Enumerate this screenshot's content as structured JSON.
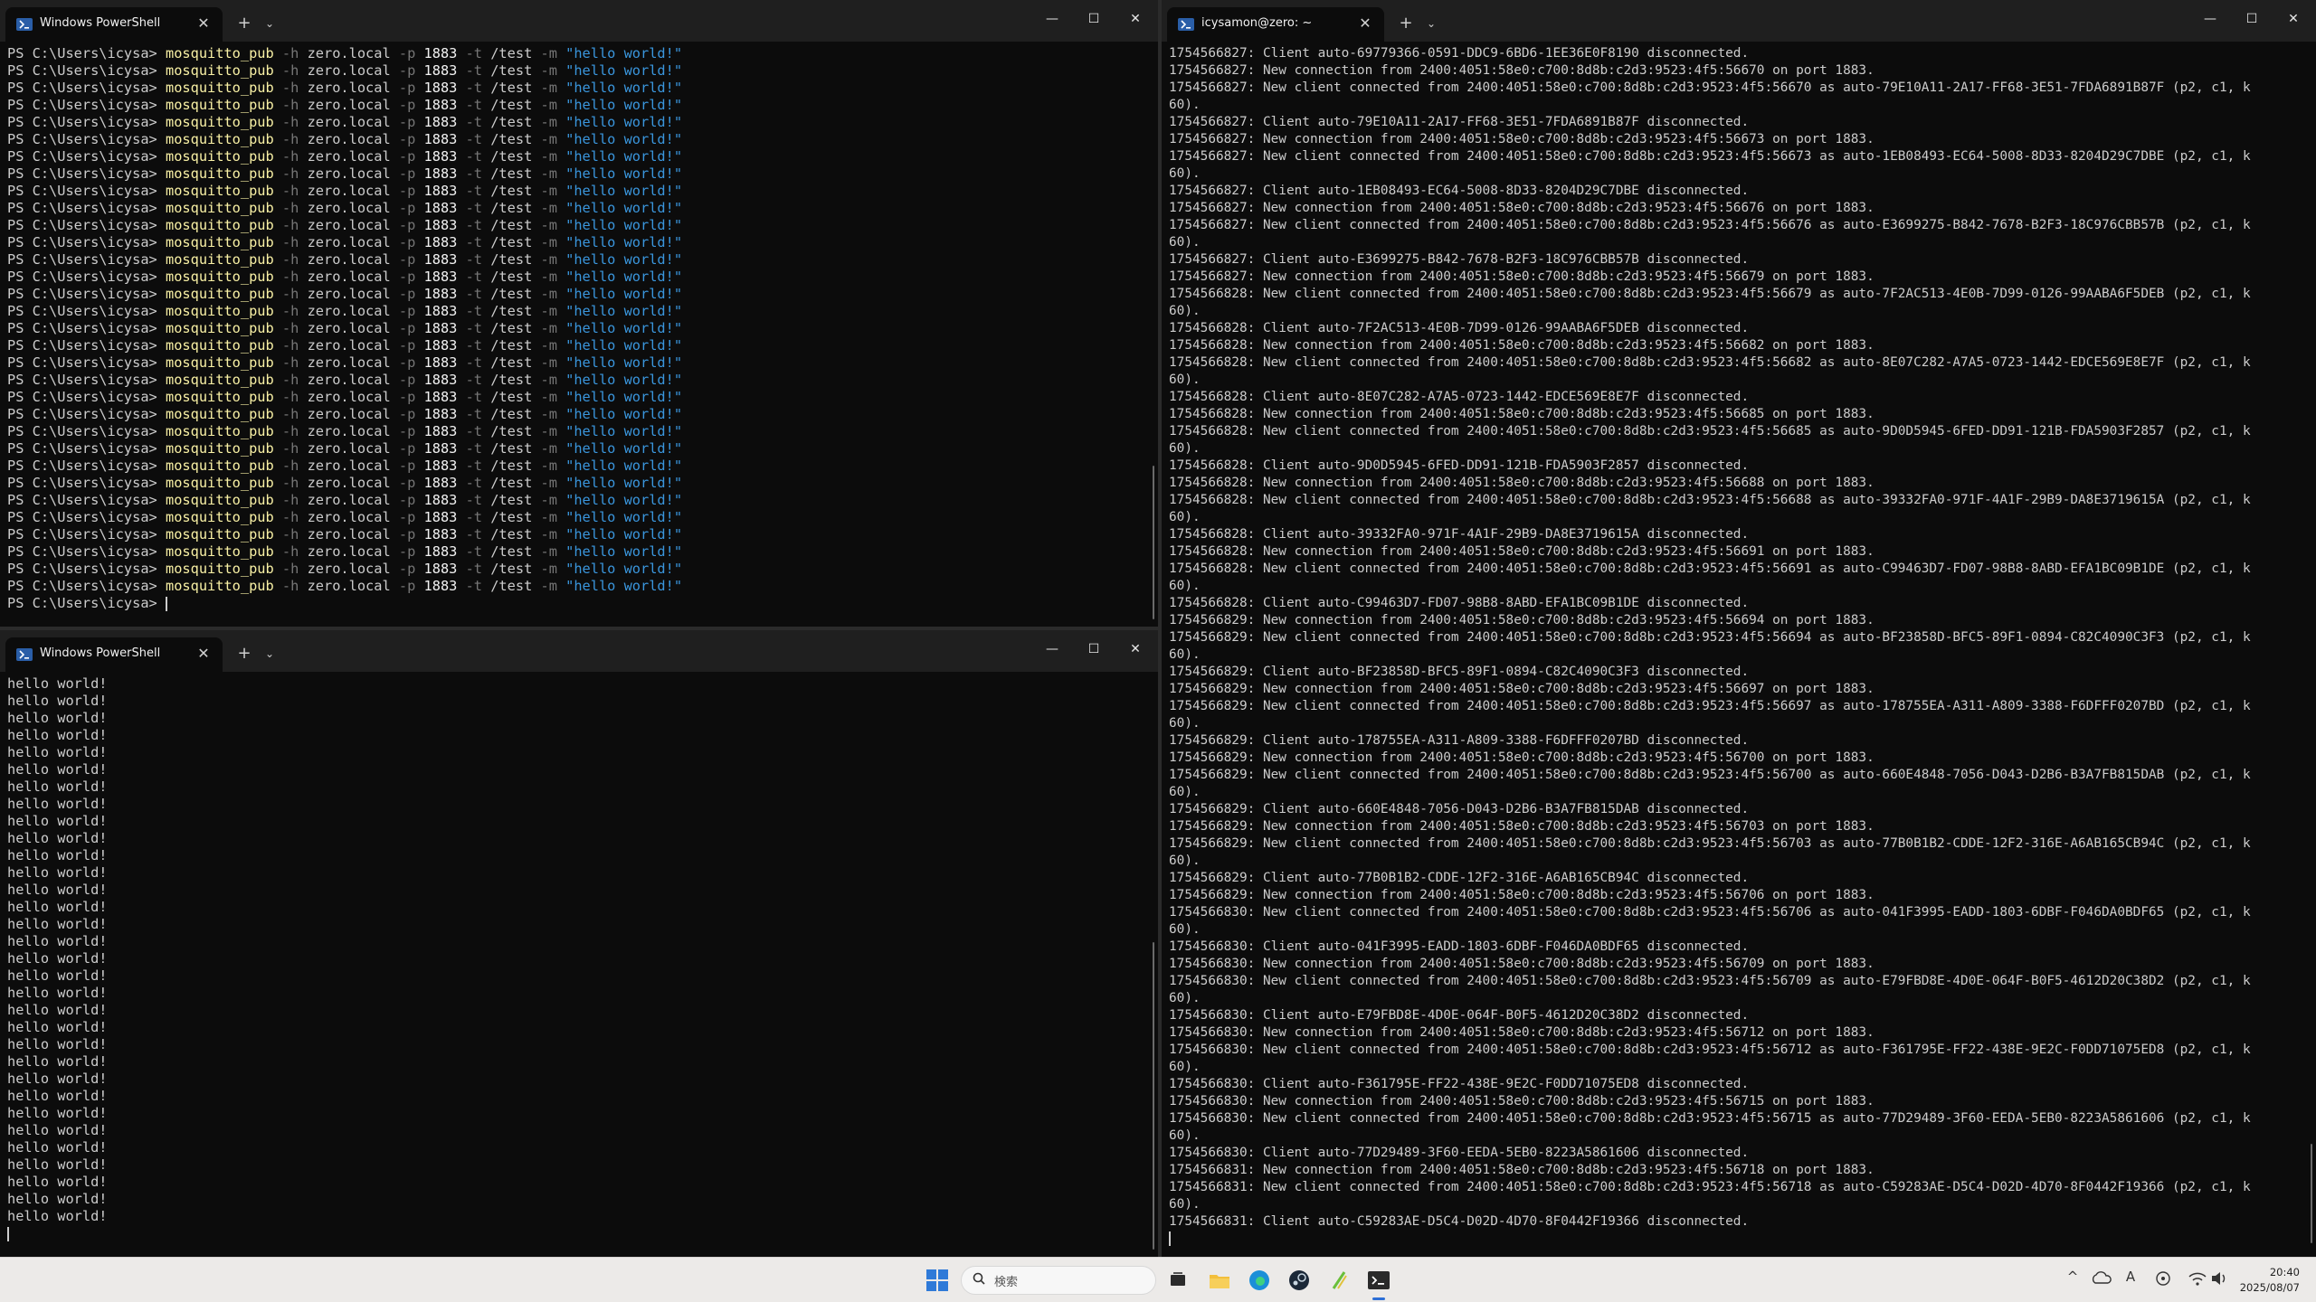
{
  "windows": {
    "top_left": {
      "tab_title": "Windows PowerShell",
      "command": {
        "prompt": "PS C:\\Users\\icysa> ",
        "exe": "mosquitto_pub",
        "h_flag": "-h",
        "host": "zero.local",
        "p_flag": "-p",
        "port": "1883",
        "t_flag": "-t",
        "topic": "/test",
        "m_flag": "-m",
        "message": "\"hello world!\"",
        "repeat": 32
      },
      "final_prompt": "PS C:\\Users\\icysa> "
    },
    "bottom_left": {
      "tab_title": "Windows PowerShell",
      "line": "hello world!",
      "repeat": 32
    },
    "right": {
      "tab_title": "icysamon@zero: ~",
      "lines": [
        "1754566827: Client auto-69779366-0591-DDC9-6BD6-1EE36E0F8190 disconnected.",
        "1754566827: New connection from 2400:4051:58e0:c700:8d8b:c2d3:9523:4f5:56670 on port 1883.",
        "1754566827: New client connected from 2400:4051:58e0:c700:8d8b:c2d3:9523:4f5:56670 as auto-79E10A11-2A17-FF68-3E51-7FDA6891B87F (p2, c1, k",
        "60).",
        "1754566827: Client auto-79E10A11-2A17-FF68-3E51-7FDA6891B87F disconnected.",
        "1754566827: New connection from 2400:4051:58e0:c700:8d8b:c2d3:9523:4f5:56673 on port 1883.",
        "1754566827: New client connected from 2400:4051:58e0:c700:8d8b:c2d3:9523:4f5:56673 as auto-1EB08493-EC64-5008-8D33-8204D29C7DBE (p2, c1, k",
        "60).",
        "1754566827: Client auto-1EB08493-EC64-5008-8D33-8204D29C7DBE disconnected.",
        "1754566827: New connection from 2400:4051:58e0:c700:8d8b:c2d3:9523:4f5:56676 on port 1883.",
        "1754566827: New client connected from 2400:4051:58e0:c700:8d8b:c2d3:9523:4f5:56676 as auto-E3699275-B842-7678-B2F3-18C976CBB57B (p2, c1, k",
        "60).",
        "1754566827: Client auto-E3699275-B842-7678-B2F3-18C976CBB57B disconnected.",
        "1754566827: New connection from 2400:4051:58e0:c700:8d8b:c2d3:9523:4f5:56679 on port 1883.",
        "1754566828: New client connected from 2400:4051:58e0:c700:8d8b:c2d3:9523:4f5:56679 as auto-7F2AC513-4E0B-7D99-0126-99AABA6F5DEB (p2, c1, k",
        "60).",
        "1754566828: Client auto-7F2AC513-4E0B-7D99-0126-99AABA6F5DEB disconnected.",
        "1754566828: New connection from 2400:4051:58e0:c700:8d8b:c2d3:9523:4f5:56682 on port 1883.",
        "1754566828: New client connected from 2400:4051:58e0:c700:8d8b:c2d3:9523:4f5:56682 as auto-8E07C282-A7A5-0723-1442-EDCE569E8E7F (p2, c1, k",
        "60).",
        "1754566828: Client auto-8E07C282-A7A5-0723-1442-EDCE569E8E7F disconnected.",
        "1754566828: New connection from 2400:4051:58e0:c700:8d8b:c2d3:9523:4f5:56685 on port 1883.",
        "1754566828: New client connected from 2400:4051:58e0:c700:8d8b:c2d3:9523:4f5:56685 as auto-9D0D5945-6FED-DD91-121B-FDA5903F2857 (p2, c1, k",
        "60).",
        "1754566828: Client auto-9D0D5945-6FED-DD91-121B-FDA5903F2857 disconnected.",
        "1754566828: New connection from 2400:4051:58e0:c700:8d8b:c2d3:9523:4f5:56688 on port 1883.",
        "1754566828: New client connected from 2400:4051:58e0:c700:8d8b:c2d3:9523:4f5:56688 as auto-39332FA0-971F-4A1F-29B9-DA8E3719615A (p2, c1, k",
        "60).",
        "1754566828: Client auto-39332FA0-971F-4A1F-29B9-DA8E3719615A disconnected.",
        "1754566828: New connection from 2400:4051:58e0:c700:8d8b:c2d3:9523:4f5:56691 on port 1883.",
        "1754566828: New client connected from 2400:4051:58e0:c700:8d8b:c2d3:9523:4f5:56691 as auto-C99463D7-FD07-98B8-8ABD-EFA1BC09B1DE (p2, c1, k",
        "60).",
        "1754566828: Client auto-C99463D7-FD07-98B8-8ABD-EFA1BC09B1DE disconnected.",
        "1754566829: New connection from 2400:4051:58e0:c700:8d8b:c2d3:9523:4f5:56694 on port 1883.",
        "1754566829: New client connected from 2400:4051:58e0:c700:8d8b:c2d3:9523:4f5:56694 as auto-BF23858D-BFC5-89F1-0894-C82C4090C3F3 (p2, c1, k",
        "60).",
        "1754566829: Client auto-BF23858D-BFC5-89F1-0894-C82C4090C3F3 disconnected.",
        "1754566829: New connection from 2400:4051:58e0:c700:8d8b:c2d3:9523:4f5:56697 on port 1883.",
        "1754566829: New client connected from 2400:4051:58e0:c700:8d8b:c2d3:9523:4f5:56697 as auto-178755EA-A311-A809-3388-F6DFFF0207BD (p2, c1, k",
        "60).",
        "1754566829: Client auto-178755EA-A311-A809-3388-F6DFFF0207BD disconnected.",
        "1754566829: New connection from 2400:4051:58e0:c700:8d8b:c2d3:9523:4f5:56700 on port 1883.",
        "1754566829: New client connected from 2400:4051:58e0:c700:8d8b:c2d3:9523:4f5:56700 as auto-660E4848-7056-D043-D2B6-B3A7FB815DAB (p2, c1, k",
        "60).",
        "1754566829: Client auto-660E4848-7056-D043-D2B6-B3A7FB815DAB disconnected.",
        "1754566829: New connection from 2400:4051:58e0:c700:8d8b:c2d3:9523:4f5:56703 on port 1883.",
        "1754566829: New client connected from 2400:4051:58e0:c700:8d8b:c2d3:9523:4f5:56703 as auto-77B0B1B2-CDDE-12F2-316E-A6AB165CB94C (p2, c1, k",
        "60).",
        "1754566829: Client auto-77B0B1B2-CDDE-12F2-316E-A6AB165CB94C disconnected.",
        "1754566829: New connection from 2400:4051:58e0:c700:8d8b:c2d3:9523:4f5:56706 on port 1883.",
        "1754566830: New client connected from 2400:4051:58e0:c700:8d8b:c2d3:9523:4f5:56706 as auto-041F3995-EADD-1803-6DBF-F046DA0BDF65 (p2, c1, k",
        "60).",
        "1754566830: Client auto-041F3995-EADD-1803-6DBF-F046DA0BDF65 disconnected.",
        "1754566830: New connection from 2400:4051:58e0:c700:8d8b:c2d3:9523:4f5:56709 on port 1883.",
        "1754566830: New client connected from 2400:4051:58e0:c700:8d8b:c2d3:9523:4f5:56709 as auto-E79FBD8E-4D0E-064F-B0F5-4612D20C38D2 (p2, c1, k",
        "60).",
        "1754566830: Client auto-E79FBD8E-4D0E-064F-B0F5-4612D20C38D2 disconnected.",
        "1754566830: New connection from 2400:4051:58e0:c700:8d8b:c2d3:9523:4f5:56712 on port 1883.",
        "1754566830: New client connected from 2400:4051:58e0:c700:8d8b:c2d3:9523:4f5:56712 as auto-F361795E-FF22-438E-9E2C-F0DD71075ED8 (p2, c1, k",
        "60).",
        "1754566830: Client auto-F361795E-FF22-438E-9E2C-F0DD71075ED8 disconnected.",
        "1754566830: New connection from 2400:4051:58e0:c700:8d8b:c2d3:9523:4f5:56715 on port 1883.",
        "1754566830: New client connected from 2400:4051:58e0:c700:8d8b:c2d3:9523:4f5:56715 as auto-77D29489-3F60-EEDA-5EB0-8223A5861606 (p2, c1, k",
        "60).",
        "1754566830: Client auto-77D29489-3F60-EEDA-5EB0-8223A5861606 disconnected.",
        "1754566831: New connection from 2400:4051:58e0:c700:8d8b:c2d3:9523:4f5:56718 on port 1883.",
        "1754566831: New client connected from 2400:4051:58e0:c700:8d8b:c2d3:9523:4f5:56718 as auto-C59283AE-D5C4-D02D-4D70-8F0442F19366 (p2, c1, k",
        "60).",
        "1754566831: Client auto-C59283AE-D5C4-D02D-4D70-8F0442F19366 disconnected."
      ]
    },
    "window_controls": {
      "minimize": "—",
      "maximize": "☐",
      "close": "✕"
    },
    "tab_controls": {
      "close": "✕",
      "new_tab": "+",
      "dropdown": "⌄"
    }
  },
  "taskbar": {
    "search_placeholder": "検索",
    "pinned_icons": [
      "windows-start-icon",
      "search-icon",
      "task-view-icon",
      "file-explorer-icon",
      "edge-browser-icon",
      "steam-icon",
      "notepad-icon",
      "terminal-icon"
    ],
    "tray": {
      "chevron": "^",
      "ime": "A",
      "cloud_icon": "cloud-icon",
      "wifi_icon": "wifi-icon",
      "volume_icon": "volume-icon"
    },
    "time": "20:40",
    "date": "2025/08/07"
  },
  "colors": {
    "terminal_bg": "#0c0c0c",
    "command_yellow": "#f9f1a5",
    "param_gray": "#767676",
    "string_blue": "#3a96dd",
    "text": "#cccccc"
  }
}
